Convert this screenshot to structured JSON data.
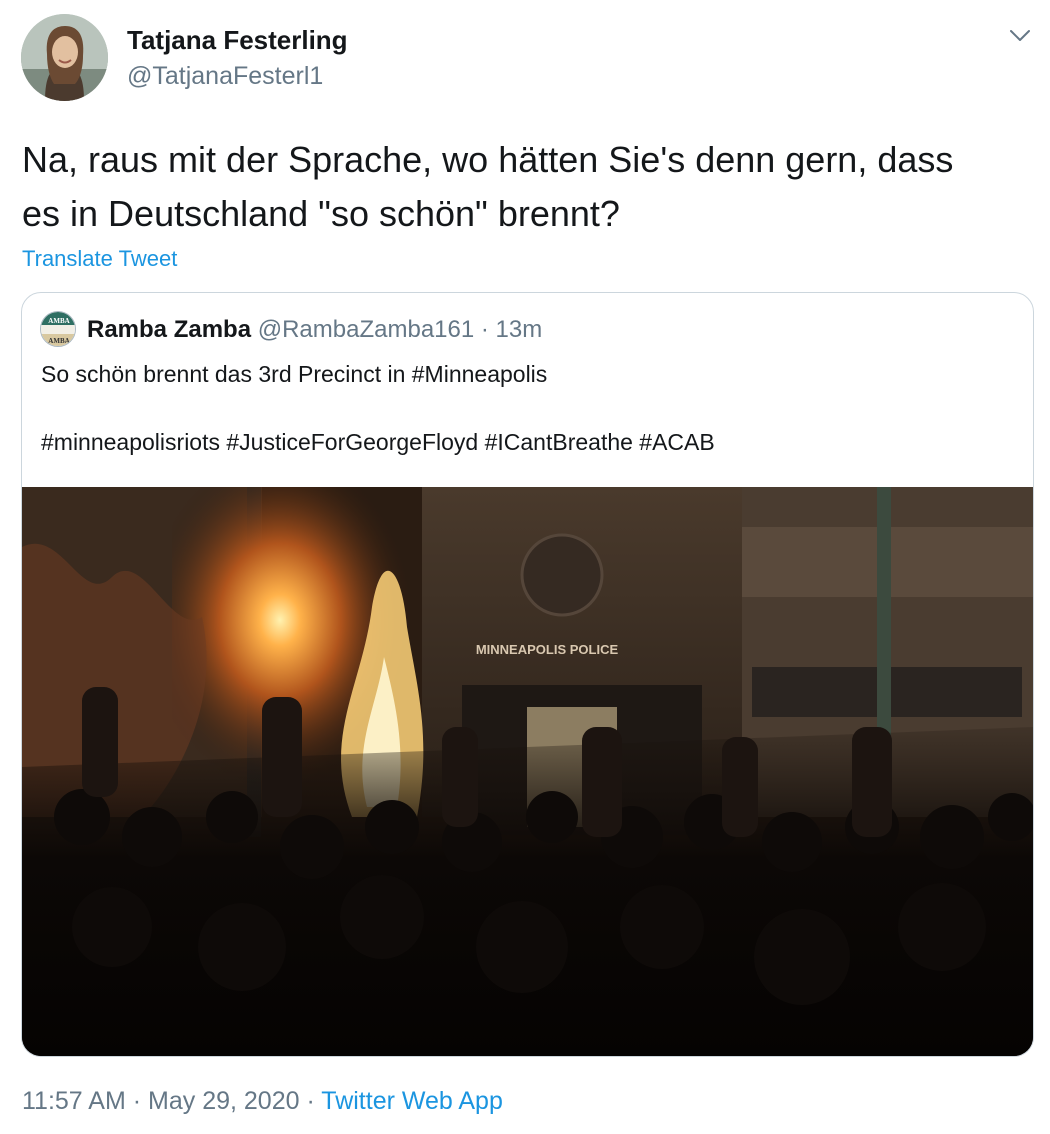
{
  "author": {
    "name": "Tatjana Festerling",
    "handle": "@TatjanaFesterl1"
  },
  "tweet": {
    "text_line1": "Na, raus mit der Sprache, wo hätten Sie's denn gern, dass",
    "text_line2": "es in Deutschland \"so schön\" brennt?",
    "translate_label": "Translate Tweet"
  },
  "quoted": {
    "name": "Ramba Zamba",
    "handle": "@RambaZamba161",
    "separator": "·",
    "time": "13m",
    "text_line1": "So schön brennt das 3rd Precinct in #Minneapolis",
    "text_line2": "#minneapolisriots #JusticeForGeorgeFloyd #ICantBreathe #ACAB",
    "avatar_text_top": "AMBA",
    "avatar_text_bottom": "AMBA",
    "photo_sign": "MINNEAPOLIS POLICE"
  },
  "meta": {
    "time": "11:57 AM",
    "separator": "·",
    "date": "May 29, 2020",
    "separator2": "·",
    "source": "Twitter Web App"
  },
  "colors": {
    "link": "#1b95e0",
    "secondary_text": "#657786",
    "primary_text": "#14171a",
    "border": "#ccd6dd"
  },
  "icons": {
    "caret": "chevron-down-icon"
  }
}
